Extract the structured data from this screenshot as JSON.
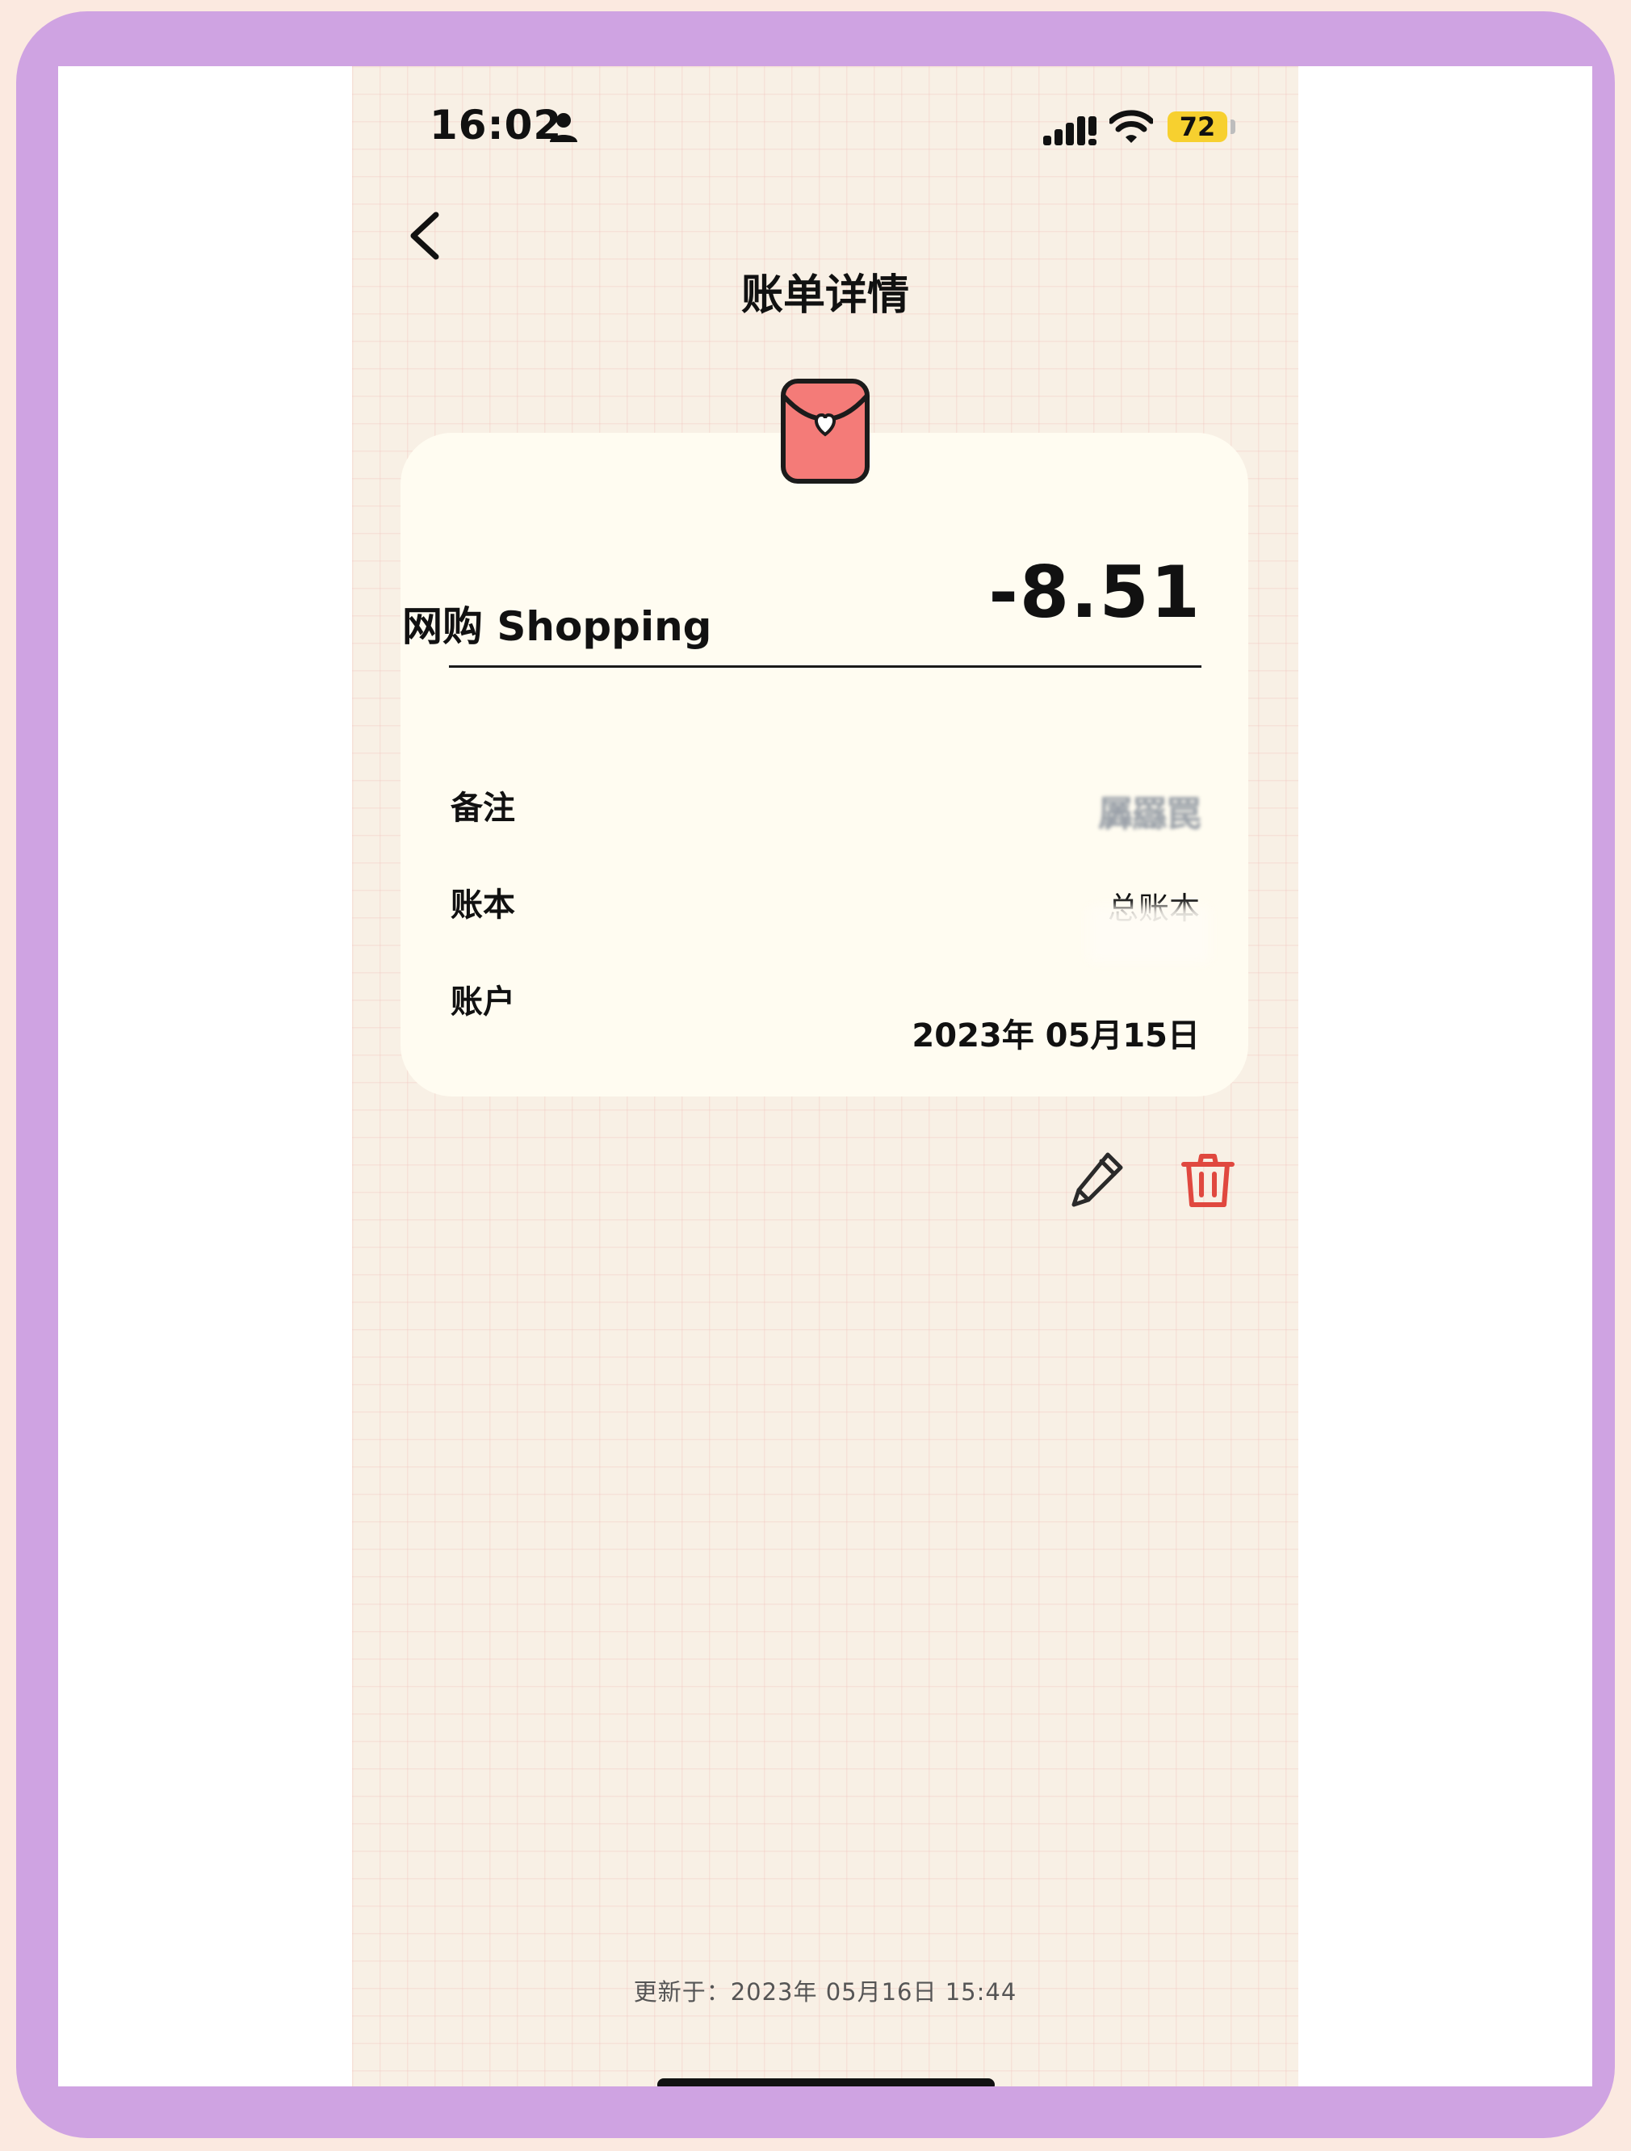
{
  "status_bar": {
    "time": "16:02",
    "battery": "72",
    "icons": [
      "person-icon",
      "signal-icon",
      "wifi-icon",
      "battery-icon"
    ]
  },
  "nav": {
    "title": "账单详情",
    "back_icon": "chevron-left-icon"
  },
  "bill": {
    "category_icon": "red-envelope-heart-icon",
    "category": "网购 Shopping",
    "amount": "-8.51",
    "rows": [
      {
        "label": "备注",
        "value": "羼羉罠"
      },
      {
        "label": "账本",
        "value": "总账本"
      },
      {
        "label": "账户",
        "value": ""
      }
    ],
    "date": "2023年 05月15日"
  },
  "actions": {
    "edit_icon": "pencil-icon",
    "delete_icon": "trash-icon",
    "delete_color": "#e0483f"
  },
  "footer": {
    "updated": "更新于：2023年 05月16日 15:44"
  },
  "colors": {
    "frame": "#cfa3e2",
    "outer_background": "#fbe9e0",
    "screen_background": "#f8f0e5",
    "card_background": "#fffcf1",
    "battery": "#f7d02f",
    "envelope": "#f47b78"
  }
}
